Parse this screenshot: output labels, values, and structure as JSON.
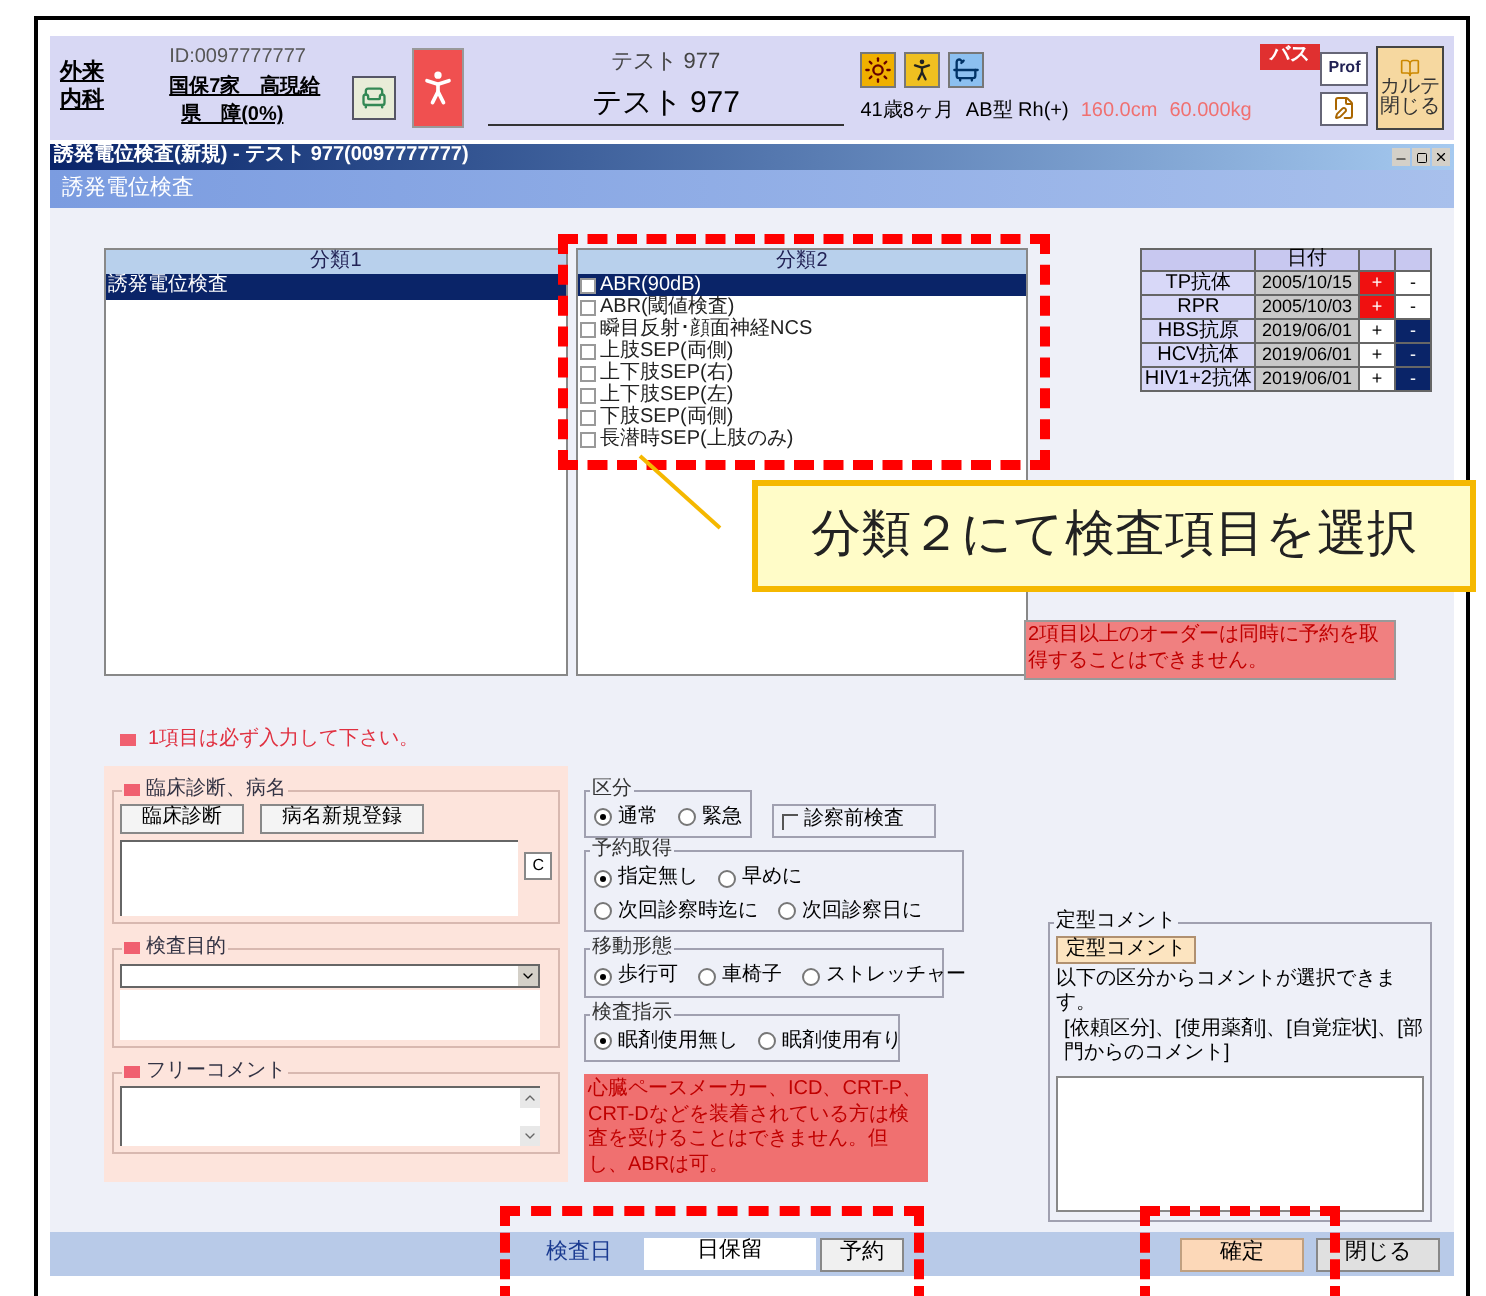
{
  "header": {
    "visit_type": "外来",
    "department": "内科",
    "patient_id": "ID:0097777777",
    "insurance_line_1": "国保7家　高現給",
    "insurance_line_2": "県　障(0%)",
    "kana_name": "テスト 977",
    "name": "テスト 977",
    "age": "41歳8ヶ月",
    "blood_type": "AB型 Rh(+)",
    "height": "160.0cm",
    "weight": "60.000kg",
    "badge": "バス",
    "prof_button": "Prof",
    "close_chart_button": "カルテ閉じる"
  },
  "window": {
    "title": "誘発電位検査(新規) - テスト 977(0097777777)",
    "heading": "誘発電位検査"
  },
  "category1": {
    "header": "分類1",
    "items": [
      {
        "label": "誘発電位検査",
        "selected": true
      }
    ]
  },
  "category2": {
    "header": "分類2",
    "items": [
      {
        "label": "ABR(90dB)",
        "selected": true,
        "checked": false
      },
      {
        "label": "ABR(閾値検査)",
        "selected": false,
        "checked": false
      },
      {
        "label": "瞬目反射･顔面神経NCS",
        "selected": false,
        "checked": false
      },
      {
        "label": "上肢SEP(両側)",
        "selected": false,
        "checked": false
      },
      {
        "label": "上下肢SEP(右)",
        "selected": false,
        "checked": false
      },
      {
        "label": "上下肢SEP(左)",
        "selected": false,
        "checked": false
      },
      {
        "label": "下肢SEP(両側)",
        "selected": false,
        "checked": false
      },
      {
        "label": "長潜時SEP(上肢のみ)",
        "selected": false,
        "checked": false
      }
    ]
  },
  "lab_table": {
    "date_header": "日付",
    "rows": [
      {
        "test": "TP抗体",
        "date": "2005/10/15",
        "plus": "+",
        "minus": "-",
        "positive": true
      },
      {
        "test": "RPR",
        "date": "2005/10/03",
        "plus": "+",
        "minus": "-",
        "positive": true
      },
      {
        "test": "HBS抗原",
        "date": "2019/06/01",
        "plus": "+",
        "minus": "-",
        "positive": false
      },
      {
        "test": "HCV抗体",
        "date": "2019/06/01",
        "plus": "+",
        "minus": "-",
        "positive": false
      },
      {
        "test": "HIV1+2抗体",
        "date": "2019/06/01",
        "plus": "+",
        "minus": "-",
        "positive": false
      }
    ]
  },
  "order_note": "2項目以上のオーダーは同時に予約を取得することはできません。",
  "callout": "分類２にて検査項目を選択",
  "required_note": "1項目は必ず入力して下さい。",
  "diagnosis": {
    "label": "臨床診断、病名",
    "buttons": [
      "臨床診断",
      "病名新規登録"
    ],
    "clear_button": "C"
  },
  "purpose": {
    "label": "検査目的"
  },
  "free_comment": {
    "label": "フリーコメント"
  },
  "classification": {
    "label": "区分",
    "options": [
      {
        "label": "通常",
        "selected": true
      },
      {
        "label": "緊急",
        "selected": false
      }
    ]
  },
  "pre_exam": {
    "label": "診察前検査",
    "checked": false
  },
  "reservation": {
    "label": "予約取得",
    "options": [
      {
        "label": "指定無し",
        "selected": true
      },
      {
        "label": "早めに",
        "selected": false
      },
      {
        "label": "次回診察時迄に",
        "selected": false
      },
      {
        "label": "次回診察日に",
        "selected": false
      }
    ]
  },
  "transport": {
    "label": "移動形態",
    "options": [
      {
        "label": "歩行可",
        "selected": true
      },
      {
        "label": "車椅子",
        "selected": false
      },
      {
        "label": "ストレッチャー",
        "selected": false
      }
    ]
  },
  "instruction": {
    "label": "検査指示",
    "options": [
      {
        "label": "眠剤使用無し",
        "selected": true
      },
      {
        "label": "眠剤使用有り",
        "selected": false
      }
    ]
  },
  "warning": "心臓ペースメーカー、ICD、CRT-P、CRT-Dなどを装着されている方は検査を受けることはできません。但し、ABRは可。",
  "template_comment": {
    "label": "定型コメント",
    "button": "定型コメント",
    "description": "以下の区分からコメントが選択できます。",
    "categories": "[依頼区分]、[使用薬剤]、[自覚症状]、[部門からのコメント]"
  },
  "footer": {
    "date_label": "検査日",
    "date_value": "日保留",
    "reserve_button": "予約",
    "confirm_button": "確定",
    "close_button": "閉じる"
  }
}
